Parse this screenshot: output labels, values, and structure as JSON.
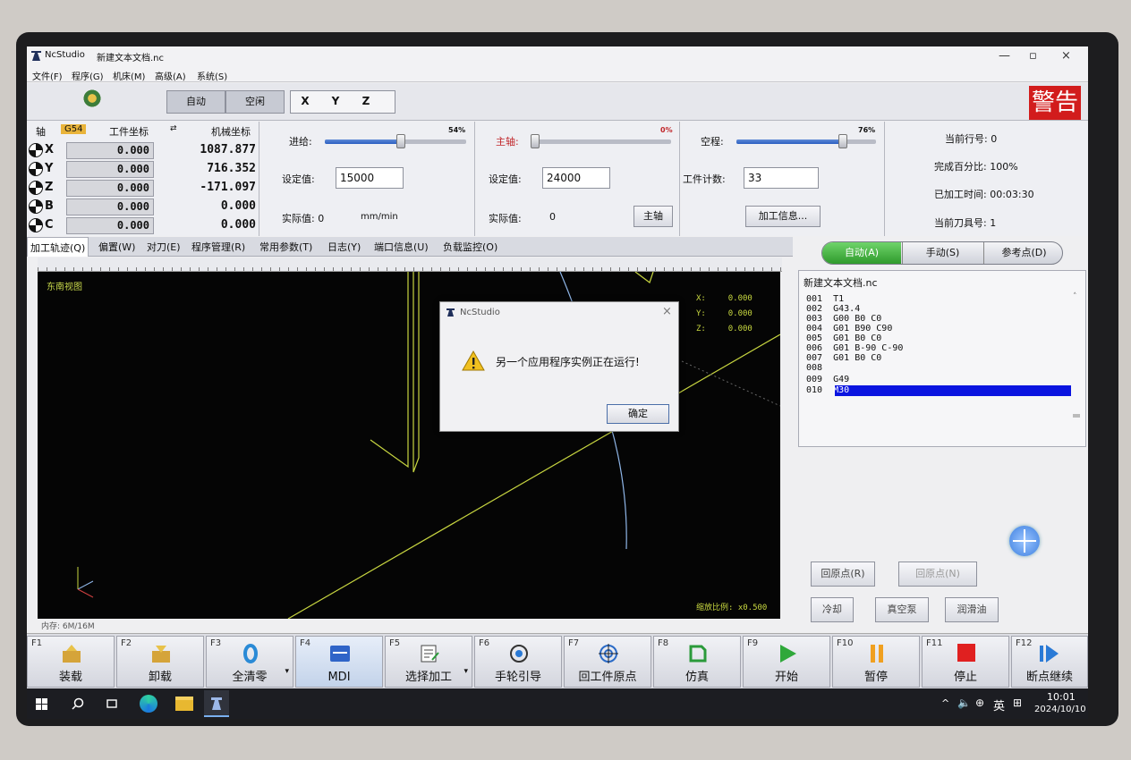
{
  "window": {
    "app": "NcStudio",
    "doc": "新建文本文档.nc",
    "min": "—",
    "max": "▫",
    "close": "×"
  },
  "menu": [
    "文件(F)",
    "程序(G)",
    "机床(M)",
    "高级(A)",
    "系统(S)"
  ],
  "toolbar": {
    "state1": "自动",
    "state2": "空闲",
    "axes": [
      "X",
      "Y",
      "Z"
    ],
    "alarm": "警告"
  },
  "coords": {
    "h_axis": "轴",
    "h_cs": "G54",
    "h_work": "工件坐标",
    "h_mach": "机械坐标",
    "rows": [
      {
        "axis": "X",
        "work": "0.000",
        "mach": "1087.877"
      },
      {
        "axis": "Y",
        "work": "0.000",
        "mach": "716.352"
      },
      {
        "axis": "Z",
        "work": "0.000",
        "mach": "-171.097"
      },
      {
        "axis": "B",
        "work": "0.000",
        "mach": "0.000"
      },
      {
        "axis": "C",
        "work": "0.000",
        "mach": "0.000"
      }
    ]
  },
  "feed": {
    "label": "进给:",
    "percent": "54%",
    "level": 0.54,
    "set_label": "设定值:",
    "set_value": "15000",
    "act_label": "实际值: 0",
    "unit": "mm/min"
  },
  "spindle": {
    "label": "主轴:",
    "percent": "0%",
    "level": 0.0,
    "set_label": "设定值:",
    "set_value": "24000",
    "act_label": "实际值:",
    "act_value": "0",
    "button": "主轴"
  },
  "rapid": {
    "label": "空程:",
    "percent": "76%",
    "level": 0.76,
    "count_label": "工件计数:",
    "count_value": "33",
    "info_button": "加工信息..."
  },
  "status": {
    "line": "当前行号: 0",
    "percent": "完成百分比: 100%",
    "time": "已加工时间: 00:03:30",
    "tool": "当前刀具号: 1"
  },
  "tabs": [
    "加工轨迹(Q)",
    "偏置(W)",
    "对刀(E)",
    "程序管理(R)",
    "常用参数(T)",
    "日志(Y)",
    "端口信息(U)",
    "负载监控(O)"
  ],
  "view": {
    "name": "东南视图",
    "readout": [
      {
        "axis": "X:",
        "val": "0.000"
      },
      {
        "axis": "Y:",
        "val": "0.000"
      },
      {
        "axis": "Z:",
        "val": "0.000"
      }
    ],
    "zoom": "缩放比例: x0.500",
    "mem": "内存: 6M/16M"
  },
  "dialog": {
    "title": "NcStudio",
    "message": "另一个应用程序实例正在运行!",
    "ok": "确定"
  },
  "modes": [
    "自动(A)",
    "手动(S)",
    "参考点(D)"
  ],
  "program": {
    "filename": "新建文本文档.nc",
    "lines": [
      {
        "n": "001",
        "code": "T1"
      },
      {
        "n": "002",
        "code": "G43.4"
      },
      {
        "n": "003",
        "code": "G00 B0 C0"
      },
      {
        "n": "004",
        "code": "G01 B90 C90"
      },
      {
        "n": "005",
        "code": "G01 B0 C0"
      },
      {
        "n": "006",
        "code": "G01 B-90 C-90"
      },
      {
        "n": "007",
        "code": "G01 B0 C0"
      },
      {
        "n": "008",
        "code": ""
      },
      {
        "n": "009",
        "code": "G49"
      },
      {
        "n": "010",
        "code": "M30"
      }
    ]
  },
  "side_buttons": {
    "home": "回原点(R)",
    "home2": "回原点(N)",
    "coolant": "冷却",
    "vacuum": "真空泵",
    "lube": "润滑油"
  },
  "fkeys": [
    {
      "key": "F1",
      "label": "装载",
      "icon": "load-icon"
    },
    {
      "key": "F2",
      "label": "卸载",
      "icon": "unload-icon"
    },
    {
      "key": "F3",
      "label": "全清零",
      "icon": "zero-icon"
    },
    {
      "key": "F4",
      "label": "MDI",
      "icon": "mdi-icon"
    },
    {
      "key": "F5",
      "label": "选择加工",
      "icon": "select-icon"
    },
    {
      "key": "F6",
      "label": "手轮引导",
      "icon": "handwheel-icon"
    },
    {
      "key": "F7",
      "label": "回工件原点",
      "icon": "target-icon"
    },
    {
      "key": "F8",
      "label": "仿真",
      "icon": "simulate-icon"
    },
    {
      "key": "F9",
      "label": "开始",
      "icon": "play-icon"
    },
    {
      "key": "F10",
      "label": "暂停",
      "icon": "pause-icon"
    },
    {
      "key": "F11",
      "label": "停止",
      "icon": "stop-icon"
    },
    {
      "key": "F12",
      "label": "断点继续",
      "icon": "resume-icon"
    }
  ],
  "taskbar": {
    "ime": "英",
    "time": "10:01",
    "date": "2024/10/10"
  }
}
